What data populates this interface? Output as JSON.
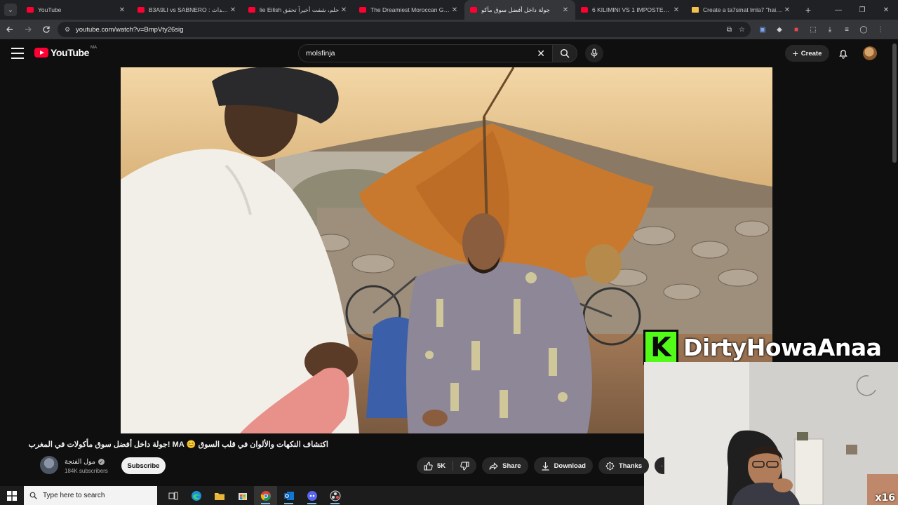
{
  "browser": {
    "tabs": [
      {
        "title": "YouTube",
        "favicon": "youtube-favicon",
        "active": false
      },
      {
        "title": "B3A9LI vs SABNERO : ج للأحداث",
        "favicon": "youtube-favicon",
        "active": false
      },
      {
        "title": "lie Eilish حلم، شفت أخيراً تحقق",
        "favicon": "youtube-favicon",
        "active": false
      },
      {
        "title": "The Dreamiest Moroccan Gate",
        "favicon": "youtube-favicon",
        "active": false
      },
      {
        "title": "جولة داخل أفضل سوق مأكو",
        "favicon": "youtube-favicon",
        "active": true
      },
      {
        "title": "6 KILIMINI VS 1 IMPOSTEUR -",
        "favicon": "youtube-favicon",
        "active": false
      },
      {
        "title": "Create a ta7sinat lmla7 \"haircu",
        "favicon": "document-favicon",
        "active": false
      }
    ],
    "url": "youtube.com/watch?v=BmpVty26sig"
  },
  "youtube": {
    "logo_text": "YouTube",
    "country_code": "MA",
    "search_value": "molsfinja",
    "create_label": "Create"
  },
  "video": {
    "title": "اكتشاف النكهات والألوان في قلب السوق 😊 MA !جولة داخل أفضل سوق مأكولات في المغرب",
    "channel_name": "مول الفنجة",
    "subscribers": "184K subscribers",
    "subscribe_label": "Subscribe",
    "likes": "5K",
    "share_label": "Share",
    "download_label": "Download",
    "thanks_label": "Thanks"
  },
  "overlay": {
    "streamer_name": "DirtyHowaAnaa",
    "kick_letter": "K",
    "speed_badge": "x16"
  },
  "taskbar": {
    "search_placeholder": "Type here to search"
  }
}
